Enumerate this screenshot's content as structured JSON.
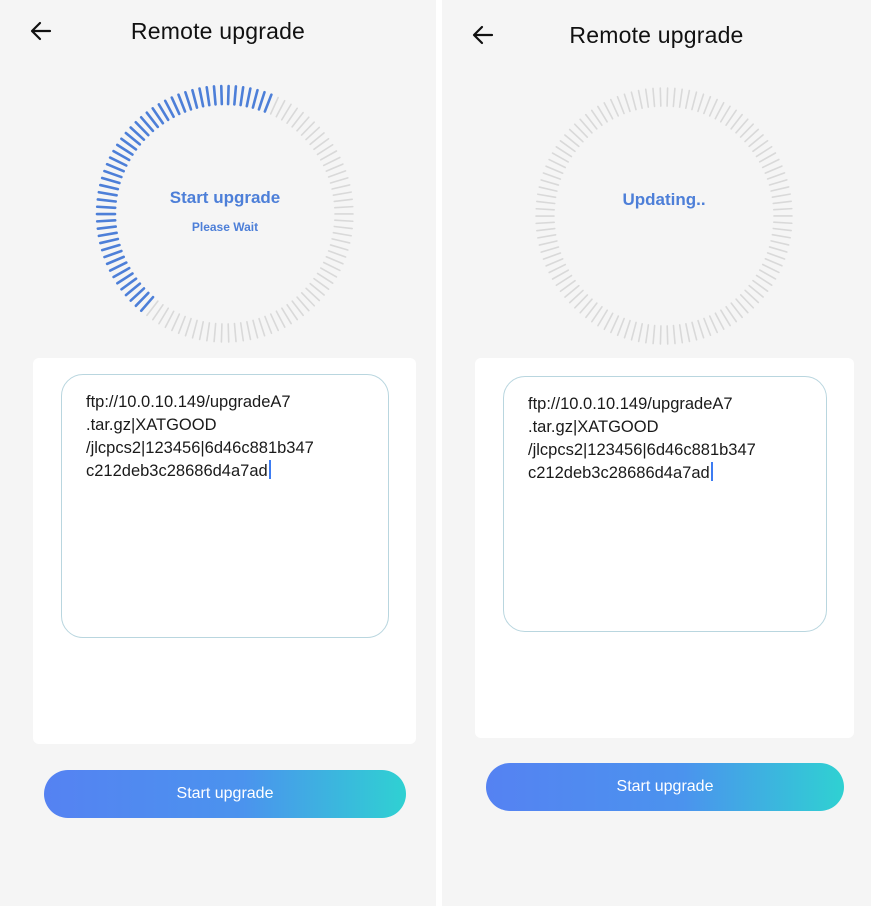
{
  "screens": [
    {
      "header": {
        "title": "Remote upgrade",
        "back_icon": "arrow-left-icon"
      },
      "progress": {
        "status": "Start upgrade",
        "substatus": "Please Wait",
        "fraction": 0.45,
        "accent": "#4d7fd8",
        "track": "#d9d9d9"
      },
      "url_field": {
        "lines": [
          "ftp://10.0.10.149/upgradeA7",
          ".tar.gz|XATGOOD",
          "/jlcpcs2|123456|6d46c881b347",
          "c212deb3c28686d4a7ad"
        ]
      },
      "button": {
        "label": "Start upgrade"
      }
    },
    {
      "header": {
        "title": "Remote upgrade",
        "back_icon": "arrow-left-icon"
      },
      "progress": {
        "status": "Updating..",
        "substatus": "",
        "fraction": 0,
        "accent": "#4d7fd8",
        "track": "#d9d9d9"
      },
      "url_field": {
        "lines": [
          "ftp://10.0.10.149/upgradeA7",
          ".tar.gz|XATGOOD",
          "/jlcpcs2|123456|6d46c881b347",
          "c212deb3c28686d4a7ad"
        ]
      },
      "button": {
        "label": "Start upgrade"
      }
    }
  ],
  "colors": {
    "background": "#f5f5f5",
    "card": "#ffffff",
    "button_gradient_start": "#5582f2",
    "button_gradient_end": "#2fd1d2"
  }
}
